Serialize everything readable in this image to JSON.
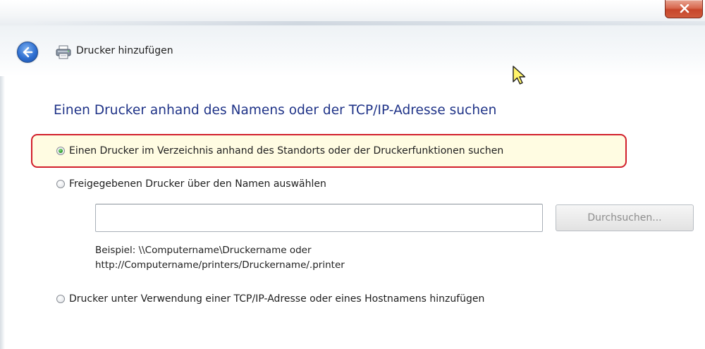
{
  "window": {
    "title": "Drucker hinzufügen",
    "close_label": "X"
  },
  "icons": {
    "back": "back-arrow-icon",
    "printer": "printer-icon",
    "close": "close-icon",
    "cursor": "mouse-pointer-icon"
  },
  "main": {
    "heading": "Einen Drucker anhand des Namens oder der TCP/IP-Adresse suchen",
    "options": [
      {
        "label": "Einen Drucker im Verzeichnis anhand des Standorts oder der Druckerfunktionen suchen",
        "selected": true
      },
      {
        "label": "Freigegebenen Drucker über den Namen auswählen",
        "selected": false
      },
      {
        "label": "Drucker unter Verwendung einer TCP/IP-Adresse oder eines Hostnamens hinzufügen",
        "selected": false
      }
    ],
    "name_input_value": "",
    "browse_label": "Durchsuchen...",
    "example_line1": "Beispiel: \\\\Computername\\Druckername oder",
    "example_line2": "http://Computername/printers/Druckername/.printer"
  },
  "colors": {
    "heading": "#1e3287",
    "highlight_border": "#d21f2b",
    "highlight_fill": "#fffce2",
    "close_button": "#c7462b"
  }
}
